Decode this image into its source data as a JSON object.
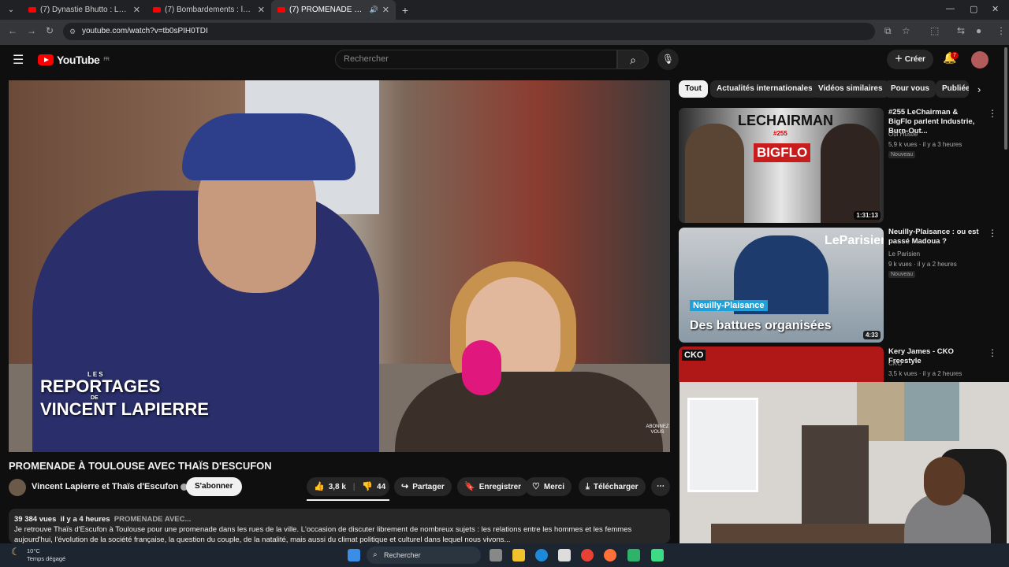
{
  "browser": {
    "tabs": [
      {
        "title": "(7) Dynastie Bhutto : La Saga S..."
      },
      {
        "title": "(7) Bombardements : la fuite et..."
      },
      {
        "title": "(7) PROMENADE À TOULO..."
      }
    ],
    "url": "youtube.com/watch?v=tb0sPIH0TDI"
  },
  "header": {
    "logo_text": "YouTube",
    "logo_region": "FR",
    "search_placeholder": "Rechercher",
    "create_label": "Créer",
    "notif_count": "7"
  },
  "video": {
    "overlay_top": "LES",
    "overlay_line1": "REPORTAGES",
    "overlay_de": "DE",
    "overlay_line2": "VINCENT LAPIERRE",
    "watermark": "ABONNEZ VOUS",
    "title": "PROMENADE À TOULOUSE AVEC THAÏS D'ESCUFON",
    "channel": "Vincent Lapierre et Thaïs d'Escufon",
    "subscribe_label": "S'abonner",
    "likes": "3,8 k",
    "dislikes": "44",
    "share_label": "Partager",
    "save_label": "Enregistrer",
    "thanks_label": "Merci",
    "download_label": "Télécharger",
    "views": "39 384 vues",
    "age": "il y a 4 heures",
    "desc_tag": "PROMENADE AVEC...",
    "description": "Je retrouve Thaïs d'Escufon à Toulouse pour une promenade dans les rues de la ville. L'occasion de discuter librement de nombreux sujets : les relations entre les hommes et les femmes aujourd'hui, l'évolution de la société française, la question du couple, de la natalité, mais aussi du climat politique et culturel dans lequel nous vivons..."
  },
  "chips": [
    "Tout",
    "Actualités internationales",
    "Vidéos similaires",
    "Pour vous",
    "Publiée"
  ],
  "recommendations": [
    {
      "title": "#255 LeChairman & BigFlo parlent Industrie, Burn-Out...",
      "channel": "Oui Hustle",
      "meta": "5,9 k vues · il y a 3 heures",
      "badge": "Nouveau",
      "duration": "1:31:13",
      "thumb_text1": "LECHAIRMAN",
      "thumb_text2": "#255",
      "thumb_text3": "BIGFLO"
    },
    {
      "title": "Neuilly-Plaisance : ou est passé Madoua ?",
      "channel": "Le Parisien",
      "meta": "9 k vues · il y a 2 heures",
      "badge": "Nouveau",
      "duration": "4:33",
      "thumb_text1": "LeParisien",
      "thumb_text2": "Neuilly-Plaisance",
      "thumb_text3": "Des battues organisées"
    },
    {
      "title": "Kery James - CKO Freestyle",
      "channel": "CKO",
      "meta": "3,5 k vues · il y a 2 heures",
      "thumb_text1": "CKO"
    }
  ],
  "taskbar": {
    "temp": "10°C",
    "weather": "Temps dégagé",
    "search": "Rechercher"
  },
  "colors": {
    "yt_red": "#ff0000",
    "bg": "#0f0f0f",
    "chip": "#272727"
  }
}
